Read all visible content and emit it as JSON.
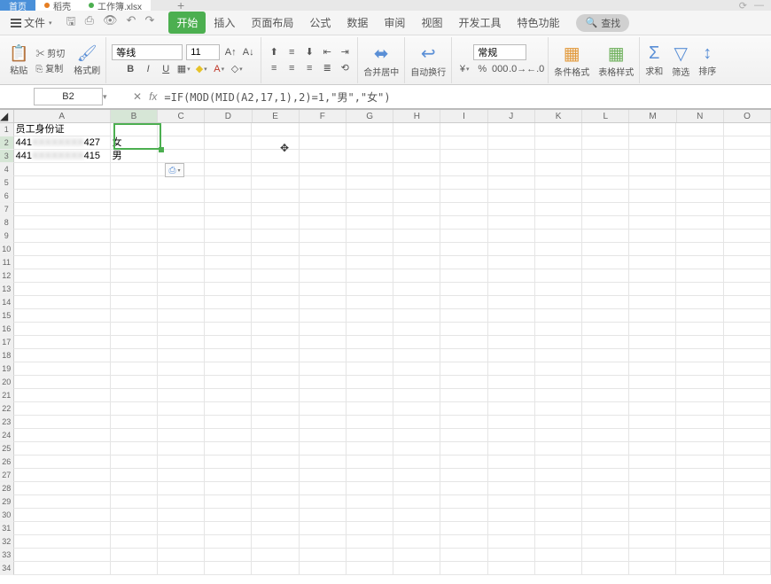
{
  "tabs": {
    "home": "首页",
    "orange": "稻壳",
    "file": "工作簿.xlsx"
  },
  "top_right": {
    "sync": "⟳",
    "dash": "—"
  },
  "file_menu": "文件",
  "menu_tabs": [
    "开始",
    "插入",
    "页面布局",
    "公式",
    "数据",
    "审阅",
    "视图",
    "开发工具",
    "特色功能"
  ],
  "find_label": "查找",
  "ribbon": {
    "paste": "粘贴",
    "cut": "剪切",
    "copy": "复制",
    "format_painter": "格式刷",
    "font_name": "等线",
    "font_size": "11",
    "merge": "合并居中",
    "wrap": "自动换行",
    "number_format": "常规",
    "cond_format": "条件格式",
    "table_style": "表格样式",
    "sum": "求和",
    "filter": "筛选",
    "sort": "排序"
  },
  "name_box": "B2",
  "formula": "=IF(MOD(MID(A2,17,1),2)=1,\"男\",\"女\")",
  "col_labels": [
    "A",
    "B",
    "C",
    "D",
    "E",
    "F",
    "G",
    "H",
    "I",
    "J",
    "K",
    "L",
    "M",
    "N",
    "O"
  ],
  "row_count": 34,
  "cells": {
    "A1": "员工身份证",
    "A2_pre": "441",
    "A2_mid": "XXXXXXXX",
    "A2_post": "427",
    "A3_pre": "441",
    "A3_mid": "XXXXXXXX",
    "A3_post": "415",
    "B2": "女",
    "B3": "男"
  },
  "paste_icon": "⎙"
}
